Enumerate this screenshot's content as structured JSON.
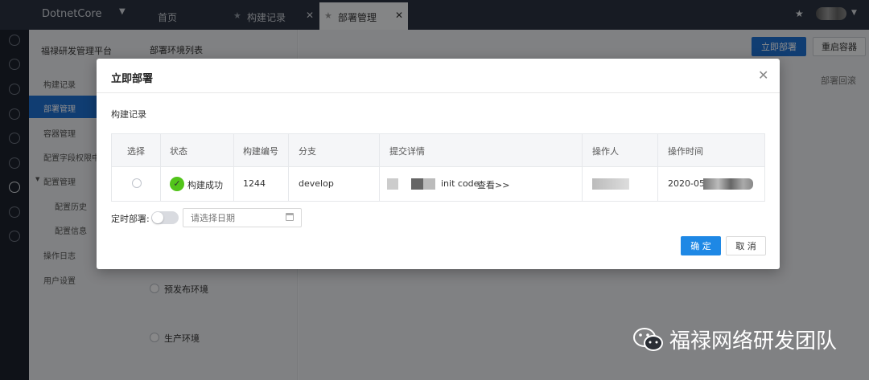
{
  "app": {
    "name": "DotnetCore"
  },
  "tabs": [
    {
      "label": "首页"
    },
    {
      "label": "构建记录"
    },
    {
      "label": "部署管理"
    }
  ],
  "sidebar": {
    "title": "福禄研发管理平台",
    "items": [
      {
        "label": "构建记录"
      },
      {
        "label": "部署管理"
      },
      {
        "label": "容器管理"
      },
      {
        "label": "配置字段权限中"
      },
      {
        "label": "配置管理"
      },
      {
        "label": "配置历史"
      },
      {
        "label": "配置信息"
      },
      {
        "label": "操作日志"
      },
      {
        "label": "用户设置"
      }
    ]
  },
  "env_panel": {
    "title": "部署环境列表",
    "items": [
      {
        "label": "预发布环境"
      },
      {
        "label": "生产环境"
      }
    ]
  },
  "main": {
    "deploy_button": "立即部署",
    "restart_button": "重启容器",
    "rollback_column": "部署回滚"
  },
  "modal": {
    "title": "立即部署",
    "section": "构建记录",
    "table": {
      "columns": [
        "选择",
        "状态",
        "构建编号",
        "分支",
        "提交详情",
        "操作人",
        "操作时间"
      ],
      "rows": [
        {
          "status": "构建成功",
          "build_no": "1244",
          "branch": "develop",
          "commit_text": "init code",
          "commit_link": "查看>>",
          "time": "2020-05"
        }
      ]
    },
    "timer_label": "定时部署:",
    "date_placeholder": "请选择日期",
    "ok_button": "确 定",
    "cancel_button": "取 消"
  },
  "watermark": {
    "text": "福禄网络研发团队"
  },
  "colors": {
    "primary": "#1e6fd0",
    "success": "#52c41a",
    "topbar": "#2b3240"
  }
}
